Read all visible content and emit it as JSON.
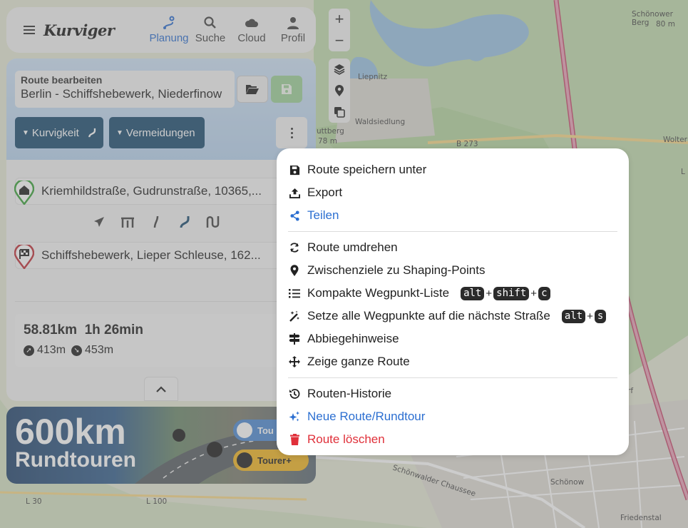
{
  "map": {
    "labels": [
      "Schönower Berg",
      "80 m",
      "Liepnitz",
      "Waldsiedlung",
      "uttberg",
      "78 m",
      "B 273",
      "Wolter",
      "L",
      "rf",
      "Schönwalder Chaussee",
      "Schönow",
      "Friedenstal",
      "L 30",
      "L 100"
    ]
  },
  "appbar": {
    "logo": "Kurviger",
    "nav": [
      {
        "label": "Planung",
        "icon": "planning-icon",
        "active": true
      },
      {
        "label": "Suche",
        "icon": "search-icon"
      },
      {
        "label": "Cloud",
        "icon": "cloud-icon"
      },
      {
        "label": "Profil",
        "icon": "profile-icon"
      }
    ]
  },
  "panel": {
    "route_label": "Route bearbeiten",
    "route_name": "Berlin - Schiffshebewerk, Niederfinow",
    "chips": {
      "curviness": "Kurvigkeit",
      "avoidances": "Vermeidungen"
    },
    "waypoints": {
      "start": "Kriemhildstraße, Gudrunstraße, 10365,...",
      "end": "Schiffshebewerk, Lieper Schleuse, 162..."
    },
    "stats": {
      "distance": "58.81km",
      "duration": "1h 26min",
      "ascent": "413m",
      "descent": "453m"
    }
  },
  "banner": {
    "headline": "600km",
    "subline": "Rundtouren",
    "pill_tour": "Tou",
    "pill_plus": "Tourer+"
  },
  "controls": {
    "zoom_in": "+",
    "zoom_out": "−"
  },
  "menu": {
    "group1": {
      "save_as": "Route speichern unter",
      "export": "Export",
      "share": "Teilen"
    },
    "group2": {
      "reverse": "Route umdrehen",
      "shaping": "Zwischenziele zu Shaping-Points",
      "compact": "Kompakte Wegpunkt-Liste",
      "compact_keys": [
        "alt",
        "shift",
        "c"
      ],
      "snap": "Setze alle Wegpunkte auf die nächste Straße",
      "snap_keys": [
        "alt",
        "s"
      ],
      "turns": "Abbiegehinweise",
      "show_route": "Zeige ganze Route"
    },
    "group3": {
      "history": "Routen-Historie",
      "new_route": "Neue Route/Rundtour",
      "delete": "Route löschen"
    },
    "key_plus": "+",
    "colors": {
      "accent": "#2c6fd1",
      "danger": "#e0303a"
    }
  }
}
